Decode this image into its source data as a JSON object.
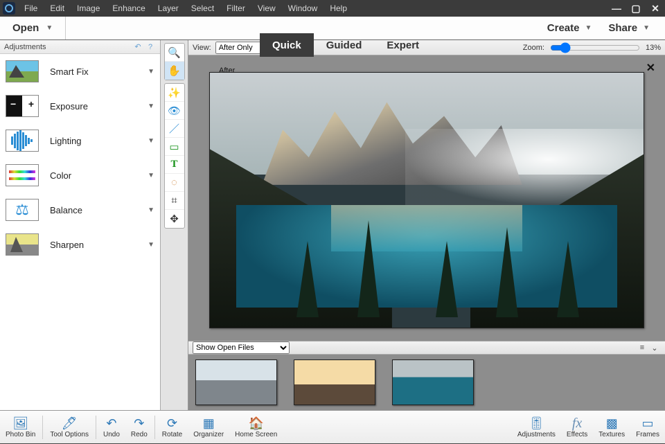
{
  "menu": {
    "items": [
      "File",
      "Edit",
      "Image",
      "Enhance",
      "Layer",
      "Select",
      "Filter",
      "View",
      "Window",
      "Help"
    ]
  },
  "modebar": {
    "open": "Open",
    "modes": [
      "Quick",
      "Guided",
      "Expert"
    ],
    "active_mode": "Quick",
    "create": "Create",
    "share": "Share"
  },
  "leftpanel": {
    "title": "Adjustments",
    "items": [
      {
        "label": "Smart Fix"
      },
      {
        "label": "Exposure"
      },
      {
        "label": "Lighting"
      },
      {
        "label": "Color"
      },
      {
        "label": "Balance"
      },
      {
        "label": "Sharpen"
      }
    ]
  },
  "tools": {
    "zoom": "zoom",
    "hand": "hand",
    "wand": "quick-select",
    "eye": "redeye",
    "whiten": "whiten",
    "straighten": "straighten",
    "text": "text",
    "heal": "spot-heal",
    "crop": "crop",
    "move": "move"
  },
  "viewbar": {
    "view_label": "View:",
    "view_value": "After Only",
    "canvas_tag": "After",
    "zoom_label": "Zoom:",
    "zoom_pct_text": "13%",
    "zoom_pct": 13
  },
  "bin": {
    "dropdown": "Show Open Files",
    "thumbs": [
      "city-aerial",
      "shore-sunset",
      "lake-mountains"
    ]
  },
  "bottombar": {
    "left": [
      "Photo Bin",
      "Tool Options",
      "Undo",
      "Redo",
      "Rotate",
      "Organizer",
      "Home Screen"
    ],
    "right": [
      "Adjustments",
      "Effects",
      "Textures",
      "Frames"
    ]
  }
}
